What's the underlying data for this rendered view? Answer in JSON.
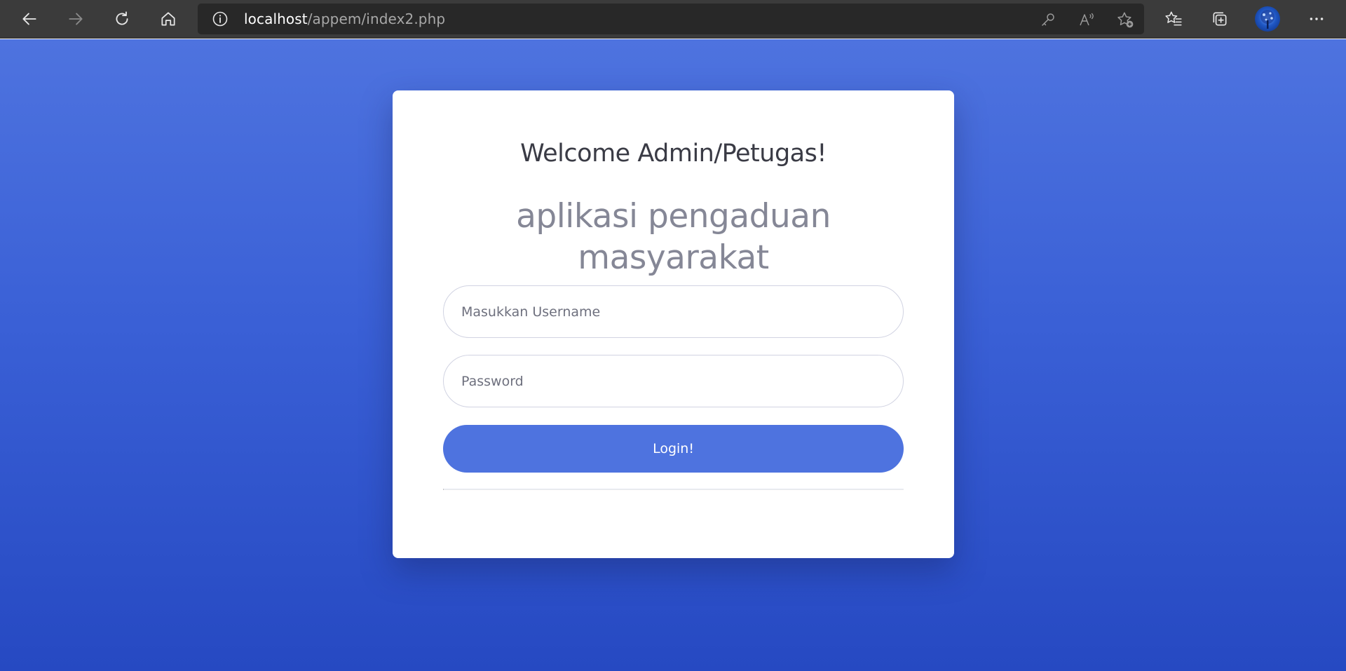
{
  "browser": {
    "url_host": "localhost",
    "url_path": "/appem/index2.php",
    "toolbar_icons": [
      "back-icon",
      "forward-icon",
      "refresh-icon",
      "home-icon",
      "site-info-icon",
      "key-icon",
      "read-aloud-icon",
      "add-favorite-icon",
      "favorites-icon",
      "collections-icon",
      "profile-avatar",
      "more-icon"
    ]
  },
  "login": {
    "welcome": "Welcome Admin/Petugas!",
    "app_name": "aplikasi pengaduan masyarakat",
    "username_placeholder": "Masukkan Username",
    "password_placeholder": "Password",
    "login_label": "Login!"
  },
  "colors": {
    "primary": "#4e73df",
    "background_top": "#4e73df",
    "background_bottom": "#2649c2",
    "card": "#ffffff",
    "heading": "#3a3b45",
    "muted": "#858796",
    "toolbar": "#3b3b3b"
  }
}
